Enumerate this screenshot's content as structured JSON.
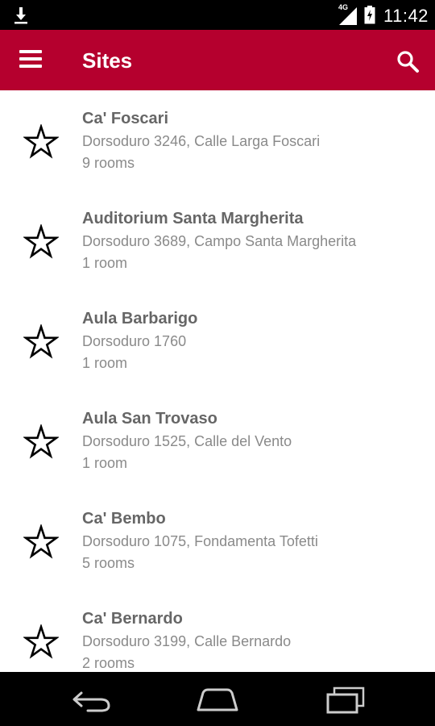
{
  "status_bar": {
    "network": "4G",
    "time": "11:42"
  },
  "app_bar": {
    "title": "Sites"
  },
  "sites": [
    {
      "name": "Ca' Foscari",
      "address": "Dorsoduro 3246, Calle Larga Foscari",
      "rooms": "9 rooms"
    },
    {
      "name": "Auditorium Santa Margherita",
      "address": "Dorsoduro 3689, Campo Santa Margherita",
      "rooms": "1 room"
    },
    {
      "name": "Aula Barbarigo",
      "address": "Dorsoduro 1760",
      "rooms": "1 room"
    },
    {
      "name": "Aula San Trovaso",
      "address": "Dorsoduro 1525, Calle del Vento",
      "rooms": "1 room"
    },
    {
      "name": "Ca' Bembo",
      "address": "Dorsoduro 1075, Fondamenta Tofetti",
      "rooms": "5 rooms"
    },
    {
      "name": "Ca' Bernardo",
      "address": "Dorsoduro 3199, Calle Bernardo",
      "rooms": "2 rooms"
    }
  ],
  "icons": {
    "status": [
      "download-icon",
      "signal-icon",
      "battery-icon"
    ],
    "app_bar": [
      "menu-icon",
      "search-icon"
    ],
    "list_item": "star-outline-icon",
    "nav": [
      "back-icon",
      "home-icon",
      "recents-icon"
    ]
  },
  "colors": {
    "app_bar": "#b5002e",
    "system_bars": "#000000",
    "title_text": "#666666",
    "secondary_text": "#8a8a8a"
  }
}
